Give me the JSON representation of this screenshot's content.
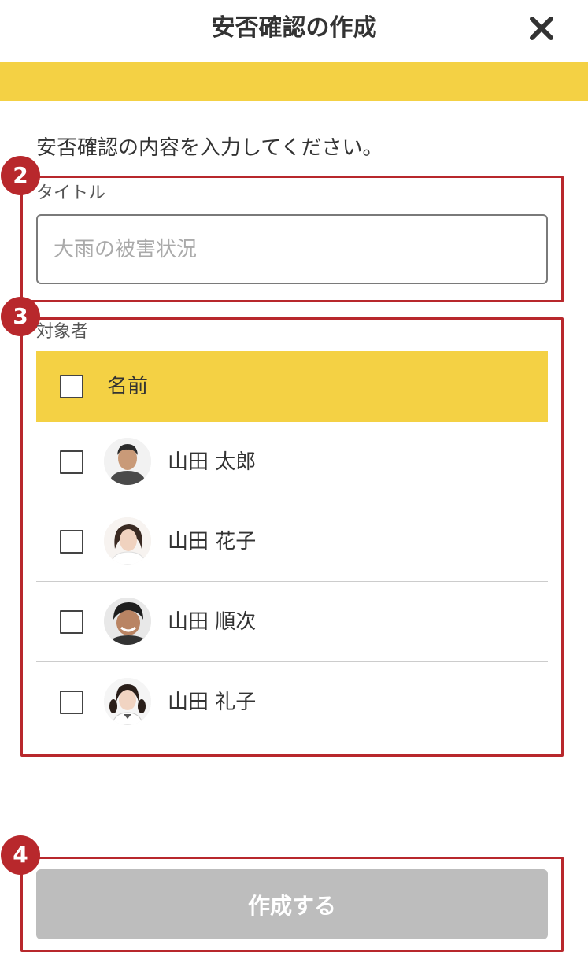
{
  "header": {
    "title": "安否確認の作成",
    "close_icon": "close-icon"
  },
  "instruction": "安否確認の内容を入力してください。",
  "annotations": [
    "2",
    "3",
    "4"
  ],
  "title_field": {
    "label": "タイトル",
    "placeholder": "大雨の被害状況",
    "value": ""
  },
  "target": {
    "label": "対象者",
    "column_header": "名前",
    "members": [
      {
        "name": "山田 太郎",
        "avatar": "avatar-man"
      },
      {
        "name": "山田 花子",
        "avatar": "avatar-woman"
      },
      {
        "name": "山田 順次",
        "avatar": "avatar-boy"
      },
      {
        "name": "山田 礼子",
        "avatar": "avatar-girl"
      }
    ]
  },
  "submit": {
    "label": "作成する"
  },
  "colors": {
    "accent_yellow": "#f4d144",
    "annotation_red": "#b8282c",
    "disabled_button": "#bdbdbd"
  }
}
